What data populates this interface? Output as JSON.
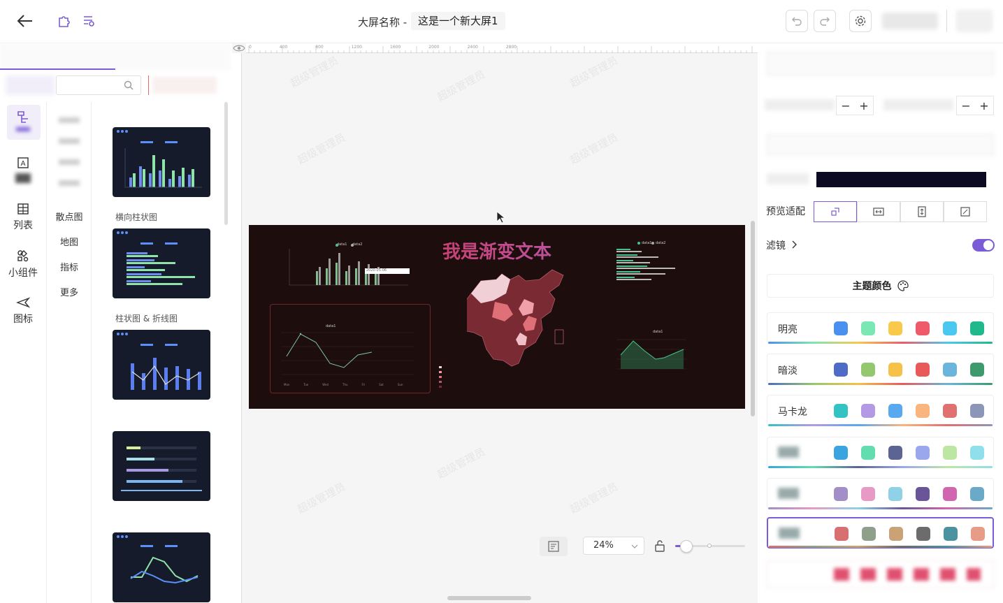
{
  "header": {
    "title_label": "大屏名称 -",
    "title_value": "这是一个新大屏1"
  },
  "sidebar": {
    "rail": [
      {
        "label": "",
        "icon": "layout-icon"
      },
      {
        "label": "",
        "icon": "text-icon"
      },
      {
        "label": "列表",
        "icon": "table-icon"
      },
      {
        "label": "小组件",
        "icon": "widgets-icon"
      },
      {
        "label": "图标",
        "icon": "plane-icon"
      }
    ],
    "subnav": [
      "散点图",
      "地图",
      "指标",
      "更多"
    ],
    "thumb_labels": [
      "横向柱状图",
      "柱状图 & 折线图"
    ]
  },
  "canvas": {
    "ruler_ticks": [
      "0",
      "400",
      "800",
      "1200",
      "1600",
      "2000",
      "2400",
      "2800"
    ],
    "screen_title": "我是渐变文本",
    "legend_data1": "data1",
    "legend_data2": "data2",
    "tooltip_date": "2020-05-06",
    "zoom_value": "24%",
    "zoom_level": 0.24,
    "watermark_line1": "超级管理员",
    "watermark_line2": "0001",
    "x_days": [
      "Mon",
      "Tue",
      "Wed",
      "Thu",
      "Fri",
      "Sat",
      "Sun"
    ]
  },
  "rightpanel": {
    "preview_fit_label": "预览适配",
    "filter_label": "滤镜",
    "filter_on": true,
    "theme_color_title": "主题颜色",
    "themes": [
      {
        "name": "明亮",
        "colors": [
          "#4a90f0",
          "#7be7b2",
          "#f8c94a",
          "#ef5a6a",
          "#4ac8f0",
          "#1fb98c"
        ],
        "bar": "#1fb98c"
      },
      {
        "name": "暗淡",
        "colors": [
          "#4e6bc5",
          "#93c86e",
          "#f6c146",
          "#e85a5a",
          "#6ab5db",
          "#3c9a6c"
        ],
        "bar": "#3c9a6c"
      },
      {
        "name": "马卡龙",
        "colors": [
          "#33c3c3",
          "#b49ae4",
          "#58a9ef",
          "#f9b57e",
          "#e17070",
          "#8c97b8"
        ],
        "bar": "#8c97b8"
      },
      {
        "name": "",
        "colors": [
          "#3aa4e0",
          "#63dcb0",
          "#5c6494",
          "#9aa7ec",
          "#bde6a3",
          "#8fdfec"
        ],
        "bar": "#8fdfec"
      },
      {
        "name": "",
        "colors": [
          "#a38ec8",
          "#e89ac6",
          "#8fd2e8",
          "#6a5598",
          "#d265b0",
          "#6aa9c8"
        ],
        "bar": "#8aa7d0"
      },
      {
        "name": "",
        "colors": [
          "#d87070",
          "#8fa08a",
          "#c9a275",
          "#6c6c6c",
          "#4d92a0",
          "#e89b86"
        ],
        "bar": "#c2a2d8"
      }
    ],
    "accent": "#7c5cd6"
  }
}
